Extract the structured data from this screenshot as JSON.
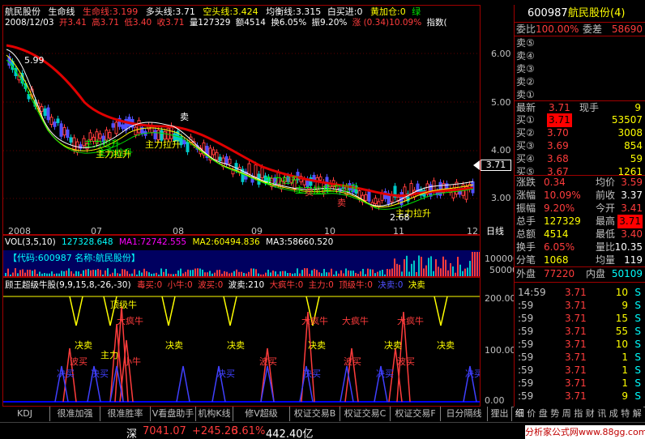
{
  "header": {
    "stock_name": "航民股份",
    "indicator": "生命线",
    "life_line": "生命线:3.199",
    "bull_line": "多头线:3.71",
    "bear_line": "空头线:3.424",
    "balance_line": "均衡线:3.315",
    "white_buy": "白买进:0",
    "yellow_add": "黄加仓:0",
    "green_tag": "绿",
    "date": "2008/12/03",
    "open": "开3.41",
    "high": "高3.71",
    "low": "低3.40",
    "close": "收3.71",
    "volume": "量127329",
    "amount": "额4514",
    "turnover": "换6.05%",
    "amplitude": "振9.20%",
    "change": "涨 (0.34)10.09%",
    "index_label": "指数("
  },
  "main_chart": {
    "y_ticks": [
      "6.00",
      "5.00",
      "4.00",
      "3.00"
    ],
    "x_ticks": [
      "2008",
      "07",
      "08",
      "09",
      "10",
      "11",
      "12"
    ],
    "x_axis_label": "日线",
    "price_tag": "3.71",
    "max_label": "5.99",
    "min_label": "2.68",
    "annotations": [
      "主力拉升",
      "主力拉升",
      "主力拉升",
      "主力拉升",
      "主力拉升",
      "主力拉升",
      "主力拉升",
      "卖",
      "卖",
      "卖",
      "主力拉升"
    ]
  },
  "volume_panel": {
    "title": "VOL(3,5,10)",
    "v1": "127328.648",
    "ma1": "MA1:72742.555",
    "ma2": "MA2:60494.836",
    "ma3": "MA3:58660.520",
    "code_label": "【代码:600987 名称:航民股份】",
    "y_ticks": [
      "100000",
      "50000"
    ]
  },
  "indicator_panel": {
    "title": "顾王超级牛股(9,9,15,8,-26,-30)",
    "items": [
      "毒买:0",
      "小牛:0",
      "波买:0",
      "波卖:210",
      "大疯牛:0",
      "主力:0",
      "顶级牛:0",
      "决卖:0",
      "决卖"
    ],
    "y_ticks": [
      "200.00",
      "100.00",
      "0.00"
    ],
    "labels": [
      "顶级牛",
      "大疯牛",
      "大疯牛",
      "大疯牛",
      "决卖",
      "决卖",
      "决卖",
      "决卖",
      "决卖",
      "决卖",
      "主力",
      "小牛",
      "波买",
      "波买",
      "波买",
      "波买",
      "决买",
      "决买",
      "决买",
      "决买",
      "决买",
      "决买"
    ]
  },
  "bottom_tabs": [
    "KDJ",
    "很准加强",
    "很准胜率",
    "V看盘助手",
    "机构K线",
    "修V超级MACD",
    "权证交易B",
    "权证交易C",
    "权证交易F",
    "日分隔线",
    "狸出"
  ],
  "bottom_right_tabs": [
    "细",
    "价",
    "盘",
    "势",
    "周",
    "指",
    "财",
    "讯",
    "成",
    "特",
    "解"
  ],
  "status_bar": {
    "market": "深",
    "index": "7041.07",
    "change": "+245.26",
    "pct": "3.61%",
    "amount": "442.40亿"
  },
  "watermark": "分析家公式网www.88gg.com",
  "quote": {
    "code": "600987",
    "name": "航民股份(4)",
    "weibi_label": "委比",
    "weibi": "100.00%",
    "weicha_label": "委差",
    "weicha": "58690",
    "sells": [
      {
        "label": "卖⑤",
        "price": "",
        "vol": ""
      },
      {
        "label": "卖④",
        "price": "",
        "vol": ""
      },
      {
        "label": "卖③",
        "price": "",
        "vol": ""
      },
      {
        "label": "卖②",
        "price": "",
        "vol": ""
      },
      {
        "label": "卖①",
        "price": "",
        "vol": ""
      }
    ],
    "latest_label": "最新",
    "latest": "3.71",
    "now_hand_label": "现手",
    "now_hand": "9",
    "buys": [
      {
        "label": "买①",
        "price": "3.71",
        "vol": "53507"
      },
      {
        "label": "买②",
        "price": "3.70",
        "vol": "3008"
      },
      {
        "label": "买③",
        "price": "3.69",
        "vol": "854"
      },
      {
        "label": "买④",
        "price": "3.68",
        "vol": "59"
      },
      {
        "label": "买⑤",
        "price": "3.67",
        "vol": "1261"
      }
    ],
    "stats": [
      {
        "l1": "涨跌",
        "v1": "0.34",
        "l2": "均价",
        "v2": "3.59"
      },
      {
        "l1": "涨幅",
        "v1": "10.09%",
        "l2": "前收",
        "v2": "3.37"
      },
      {
        "l1": "振幅",
        "v1": "9.20%",
        "l2": "今开",
        "v2": "3.41"
      },
      {
        "l1": "总手",
        "v1": "127329",
        "l2": "最高",
        "v2": "3.71"
      },
      {
        "l1": "总额",
        "v1": "4514",
        "l2": "最低",
        "v2": "3.40"
      },
      {
        "l1": "换手",
        "v1": "6.05%",
        "l2": "量比",
        "v2": "10.35"
      },
      {
        "l1": "分笔",
        "v1": "1068",
        "l2": "均量",
        "v2": "119"
      }
    ],
    "outer_label": "外盘",
    "outer": "77220",
    "inner_label": "内盘",
    "inner": "50109",
    "ticks": [
      {
        "t": "14:59",
        "p": "3.71",
        "v": "10",
        "s": "S"
      },
      {
        "t": ":59",
        "p": "3.71",
        "v": "9",
        "s": "S"
      },
      {
        "t": ":59",
        "p": "3.71",
        "v": "15",
        "s": "S"
      },
      {
        "t": ":59",
        "p": "3.71",
        "v": "55",
        "s": "S"
      },
      {
        "t": ":59",
        "p": "3.71",
        "v": "10",
        "s": "S"
      },
      {
        "t": ":59",
        "p": "3.71",
        "v": "1",
        "s": "S"
      },
      {
        "t": ":59",
        "p": "3.71",
        "v": "1",
        "s": "S"
      },
      {
        "t": ":59",
        "p": "3.71",
        "v": "1",
        "s": "S"
      },
      {
        "t": ":59",
        "p": "3.71",
        "v": "9",
        "s": "S"
      }
    ]
  },
  "colors": {
    "up": "#ff3c3c",
    "down": "#00c8c8",
    "life_line": "#e00000",
    "bull_line": "#ffffff",
    "bear_line": "#ffff00",
    "balance_line": "#00e000",
    "border": "#a00000",
    "highlight": "#ff0000"
  }
}
